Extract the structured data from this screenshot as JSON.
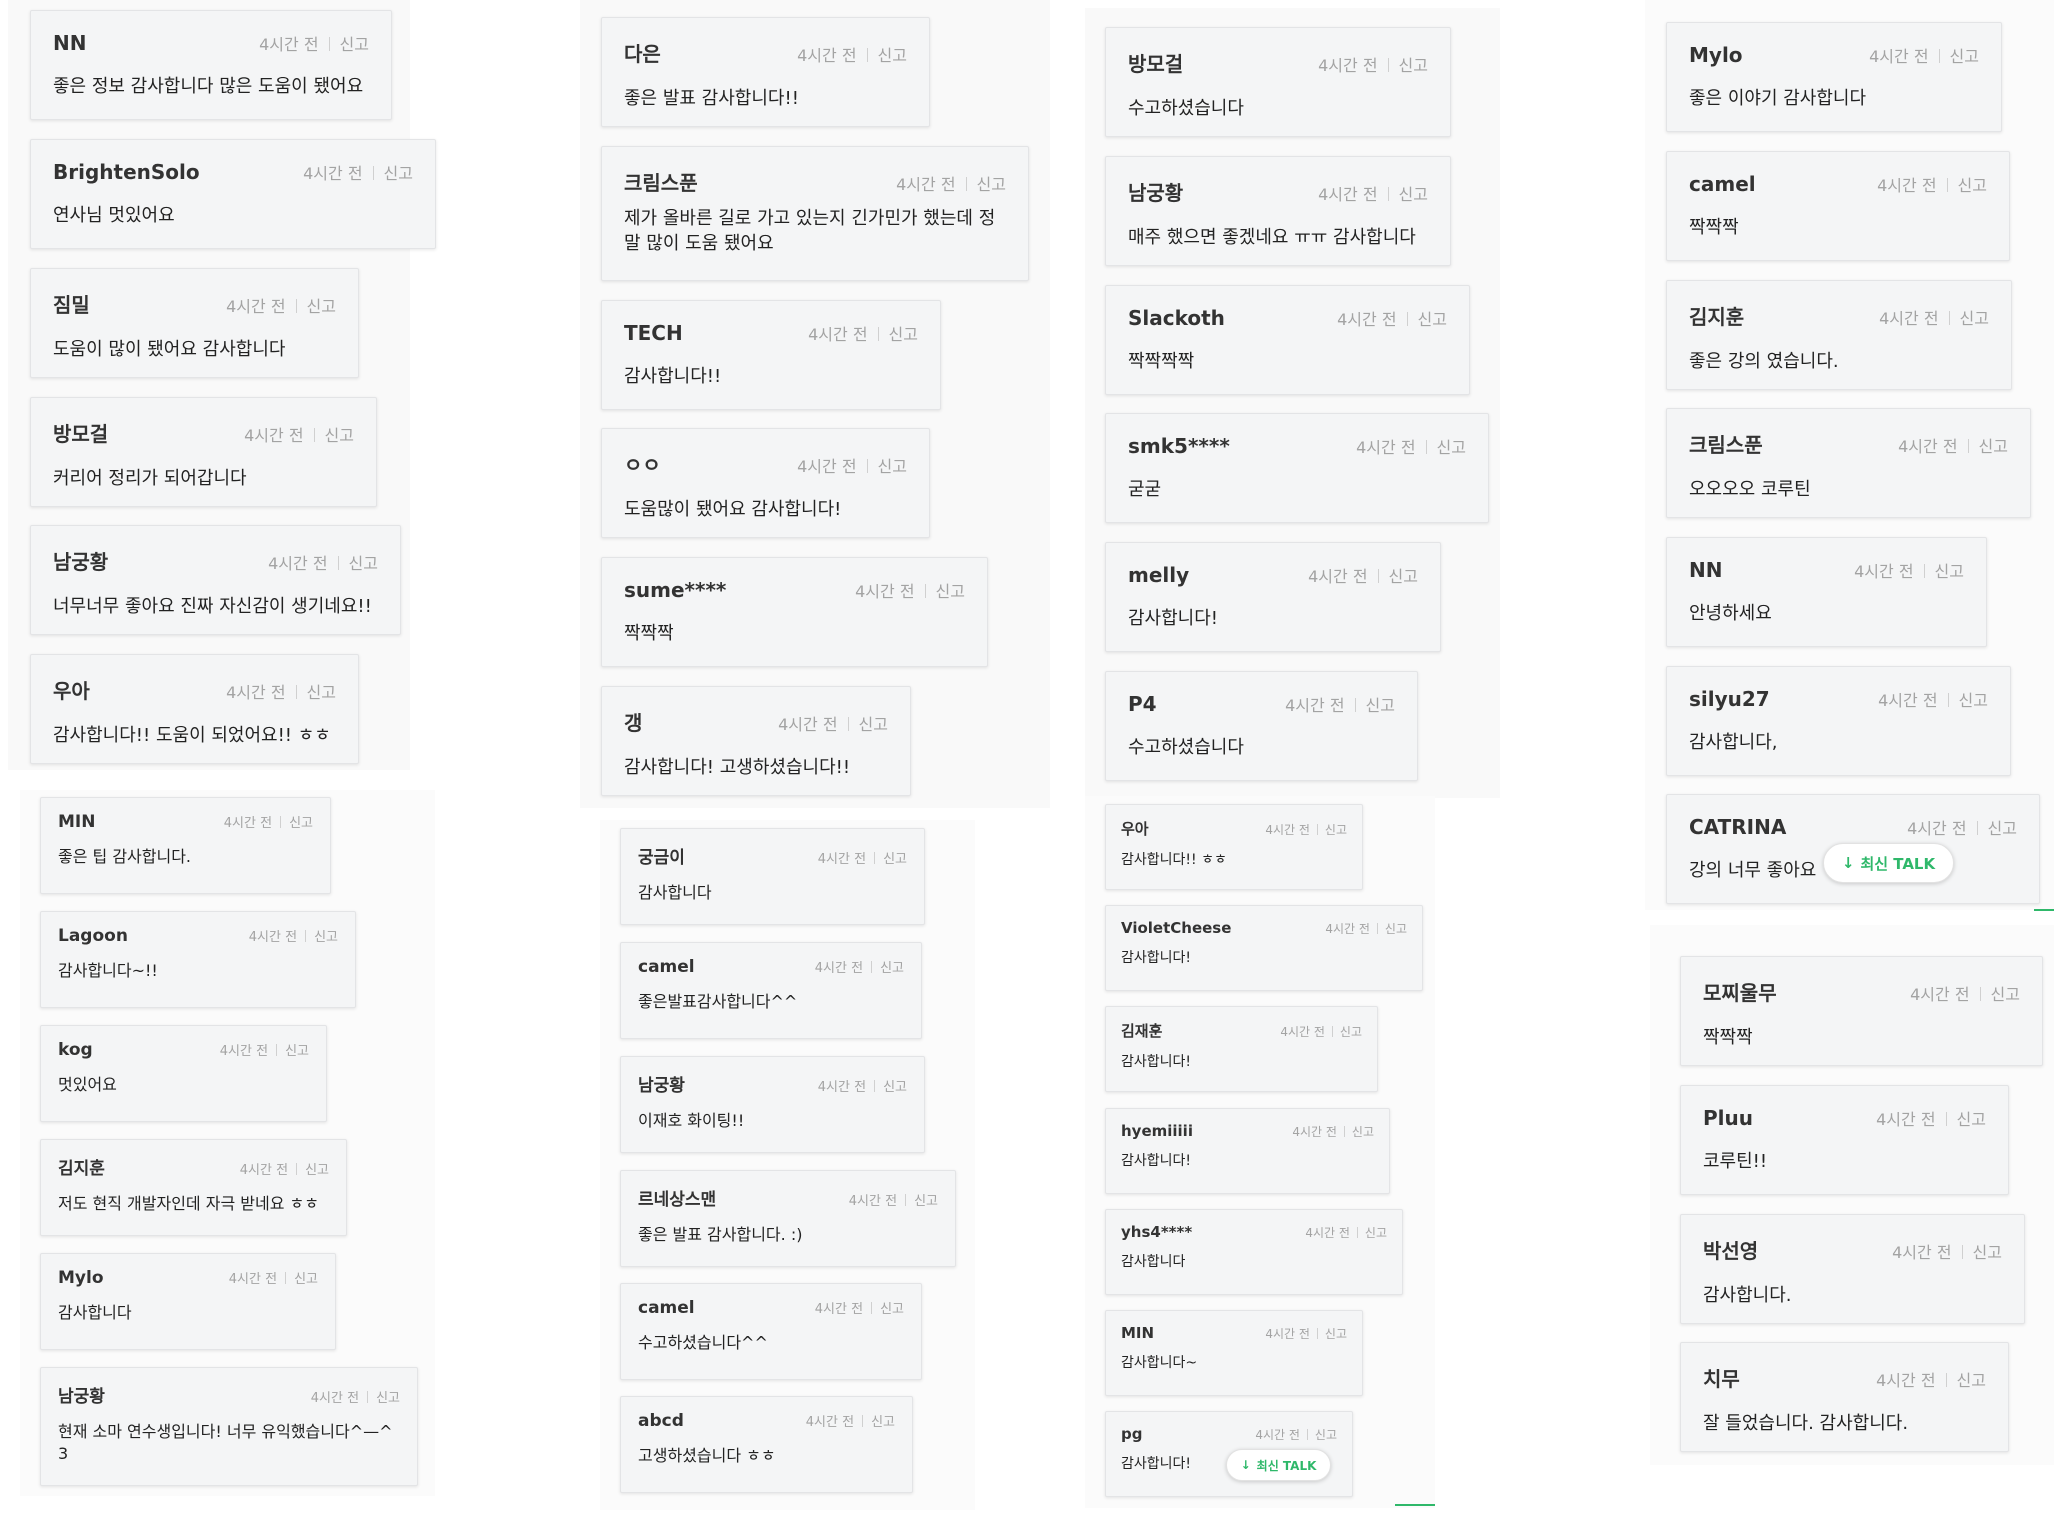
{
  "ui": {
    "time_text": "4시간 전",
    "report_text": "신고",
    "latest_talk": "최신 TALK",
    "arrow_glyph": "↓"
  },
  "columns": [
    [
      {
        "author": "NN",
        "msg": "좋은 정보 감사합니다 많은 도움이 됐어요"
      },
      {
        "author": "BrightenSolo",
        "msg": "연사님 멋있어요"
      },
      {
        "author": "짐밀",
        "msg": "도움이 많이 됐어요 감사합니다"
      },
      {
        "author": "방모걸",
        "msg": "커리어 정리가 되어갑니다"
      },
      {
        "author": "남궁황",
        "msg": "너무너무 좋아요 진짜 자신감이 생기네요!!"
      },
      {
        "author": "우아",
        "msg": "감사합니다!! 도움이 되었어요!! ㅎㅎ"
      },
      {
        "author": "MIN",
        "msg": "좋은 팁 감사합니다."
      },
      {
        "author": "Lagoon",
        "msg": "감사합니다~!!"
      },
      {
        "author": "kog",
        "msg": "멋있어요"
      },
      {
        "author": "김지훈",
        "msg": "저도 현직 개발자인데 자극 받네요 ㅎㅎ"
      },
      {
        "author": "Mylo",
        "msg": "감사합니다"
      },
      {
        "author": "남궁황",
        "msg": "현재 소마 연수생입니다! 너무 유익했습니다^—^ 3"
      }
    ],
    [
      {
        "author": "다은",
        "msg": "좋은 발표 감사합니다!!"
      },
      {
        "author": "크림스푼",
        "msg": "제가 올바른 길로 가고 있는지 긴가민가 했는데 정말 많이 도움 됐어요"
      },
      {
        "author": "TECH",
        "msg": "감사합니다!!"
      },
      {
        "author": "ㅇㅇ",
        "msg": "도움많이 됐어요 감사합니다!"
      },
      {
        "author": "sume****",
        "msg": "짝짝짝"
      },
      {
        "author": "갱",
        "msg": "감사합니다! 고생하셨습니다!!"
      },
      {
        "author": "궁금이",
        "msg": "감사합니다"
      },
      {
        "author": "camel",
        "msg": "좋은발표감사합니다^^"
      },
      {
        "author": "남궁황",
        "msg": "이재호 화이팅!!"
      },
      {
        "author": "르네상스맨",
        "msg": "좋은 발표 감사합니다. :)"
      },
      {
        "author": "camel",
        "msg": "수고하셨습니다^^"
      },
      {
        "author": "abcd",
        "msg": "고생하셨습니다 ㅎㅎ"
      }
    ],
    [
      {
        "author": "방모걸",
        "msg": "수고하셨습니다"
      },
      {
        "author": "남궁황",
        "msg": "매주 했으면 좋겠네요 ㅠㅠ 감사합니다"
      },
      {
        "author": "Slackoth",
        "msg": "짝짝짝짝"
      },
      {
        "author": "smk5****",
        "msg": "굳굳"
      },
      {
        "author": "melly",
        "msg": "감사합니다!"
      },
      {
        "author": "P4",
        "msg": "수고하셨습니다"
      },
      {
        "author": "우아",
        "msg": "감사합니다!! ㅎㅎ"
      },
      {
        "author": "VioletCheese",
        "msg": "감사합니다!"
      },
      {
        "author": "김재훈",
        "msg": "감사합니다!"
      },
      {
        "author": "hyemiiiii",
        "msg": "감사합니다!"
      },
      {
        "author": "yhs4****",
        "msg": "감사합니다"
      },
      {
        "author": "MIN",
        "msg": "감사합니다~"
      },
      {
        "author": "pg",
        "msg": "감사합니다!"
      }
    ],
    [
      {
        "author": "Mylo",
        "msg": "좋은 이야기 감사합니다"
      },
      {
        "author": "camel",
        "msg": "짝짝짝"
      },
      {
        "author": "김지훈",
        "msg": "좋은 강의 였습니다."
      },
      {
        "author": "크림스푼",
        "msg": "오오오오 코루틴"
      },
      {
        "author": "NN",
        "msg": "안녕하세요"
      },
      {
        "author": "silyu27",
        "msg": "감사합니다,"
      },
      {
        "author": "CATRINA",
        "msg": "강의 너무 좋아요"
      },
      {
        "author": "모찌울무",
        "msg": "짝짝짝"
      },
      {
        "author": "Pluu",
        "msg": "코루틴!!"
      },
      {
        "author": "박선영",
        "msg": "감사합니다."
      },
      {
        "author": "치무",
        "msg": "잘 들었습니다. 감사합니다."
      }
    ]
  ]
}
